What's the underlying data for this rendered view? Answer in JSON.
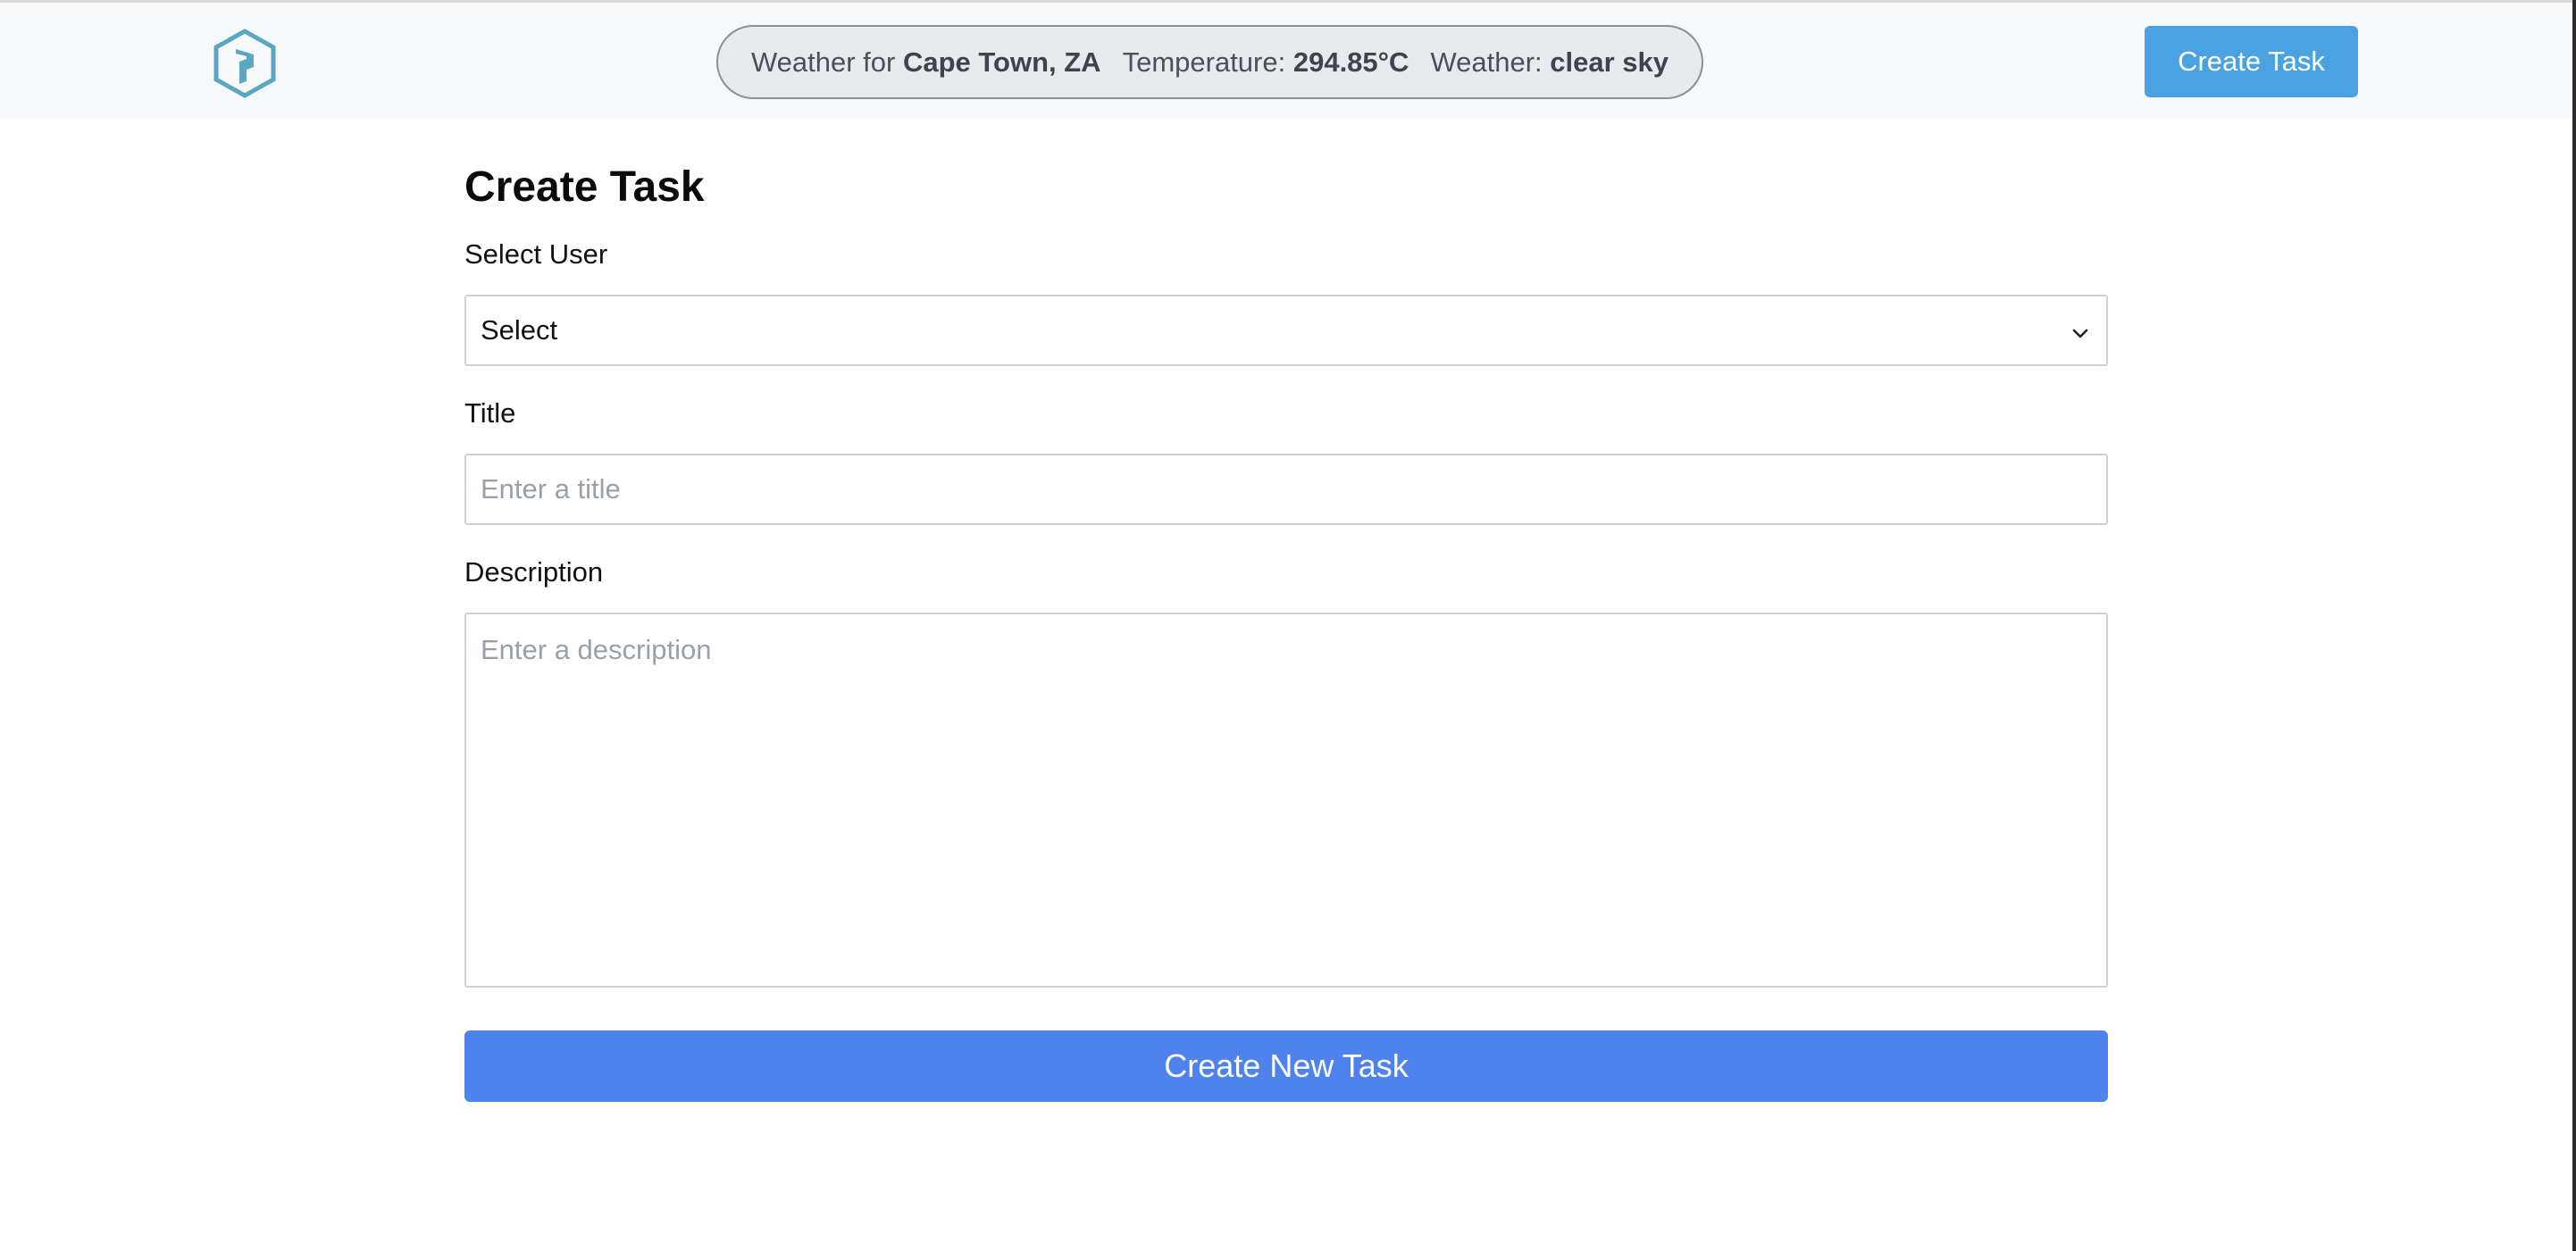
{
  "header": {
    "logo_icon": "hexagon-logo-icon",
    "weather": {
      "prefix": "Weather for",
      "location": "Cape Town, ZA",
      "temperature_label": "Temperature:",
      "temperature_value": "294.85°C",
      "condition_label": "Weather:",
      "condition_value": "clear sky"
    },
    "create_task_label": "Create Task"
  },
  "form": {
    "title": "Create Task",
    "user": {
      "label": "Select User",
      "selected": "Select"
    },
    "task_title": {
      "label": "Title",
      "placeholder": "Enter a title"
    },
    "description": {
      "label": "Description",
      "placeholder": "Enter a description"
    },
    "submit_label": "Create New Task"
  },
  "colors": {
    "header_bg": "#f7f8fa",
    "header_button": "#4aa3e0",
    "submit_button": "#4e82ec",
    "logo": "#5aa7c4"
  }
}
